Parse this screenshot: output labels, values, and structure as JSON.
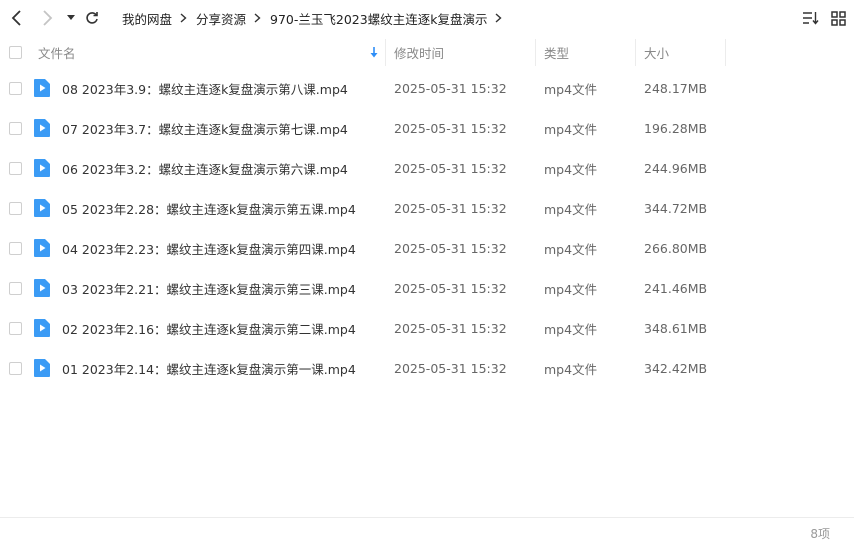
{
  "breadcrumb": [
    "我的网盘",
    "分享资源",
    "970-兰玉飞2023螺纹主连逐k复盘演示"
  ],
  "columns": {
    "name": "文件名",
    "modified": "修改时间",
    "type": "类型",
    "size": "大小"
  },
  "files": [
    {
      "name": "08 2023年3.9：螺纹主连逐k复盘演示第八课.mp4",
      "modified": "2025-05-31 15:32",
      "type": "mp4文件",
      "size": "248.17MB"
    },
    {
      "name": "07 2023年3.7：螺纹主连逐k复盘演示第七课.mp4",
      "modified": "2025-05-31 15:32",
      "type": "mp4文件",
      "size": "196.28MB"
    },
    {
      "name": "06 2023年3.2：螺纹主连逐k复盘演示第六课.mp4",
      "modified": "2025-05-31 15:32",
      "type": "mp4文件",
      "size": "244.96MB"
    },
    {
      "name": "05 2023年2.28：螺纹主连逐k复盘演示第五课.mp4",
      "modified": "2025-05-31 15:32",
      "type": "mp4文件",
      "size": "344.72MB"
    },
    {
      "name": "04 2023年2.23：螺纹主连逐k复盘演示第四课.mp4",
      "modified": "2025-05-31 15:32",
      "type": "mp4文件",
      "size": "266.80MB"
    },
    {
      "name": "03 2023年2.21：螺纹主连逐k复盘演示第三课.mp4",
      "modified": "2025-05-31 15:32",
      "type": "mp4文件",
      "size": "241.46MB"
    },
    {
      "name": "02 2023年2.16：螺纹主连逐k复盘演示第二课.mp4",
      "modified": "2025-05-31 15:32",
      "type": "mp4文件",
      "size": "348.61MB"
    },
    {
      "name": "01 2023年2.14：螺纹主连逐k复盘演示第一课.mp4",
      "modified": "2025-05-31 15:32",
      "type": "mp4文件",
      "size": "342.42MB"
    }
  ],
  "footer": {
    "count": "8项"
  },
  "icons": {
    "back": "chevron-left-icon",
    "forward": "chevron-right-icon",
    "history": "caret-down-icon",
    "refresh": "refresh-icon",
    "sort": "sort-list-icon",
    "grid": "grid-view-icon",
    "file": "video-file-icon"
  },
  "colors": {
    "accent": "#2e8ef7",
    "file_icon": "#3b9bf5"
  }
}
